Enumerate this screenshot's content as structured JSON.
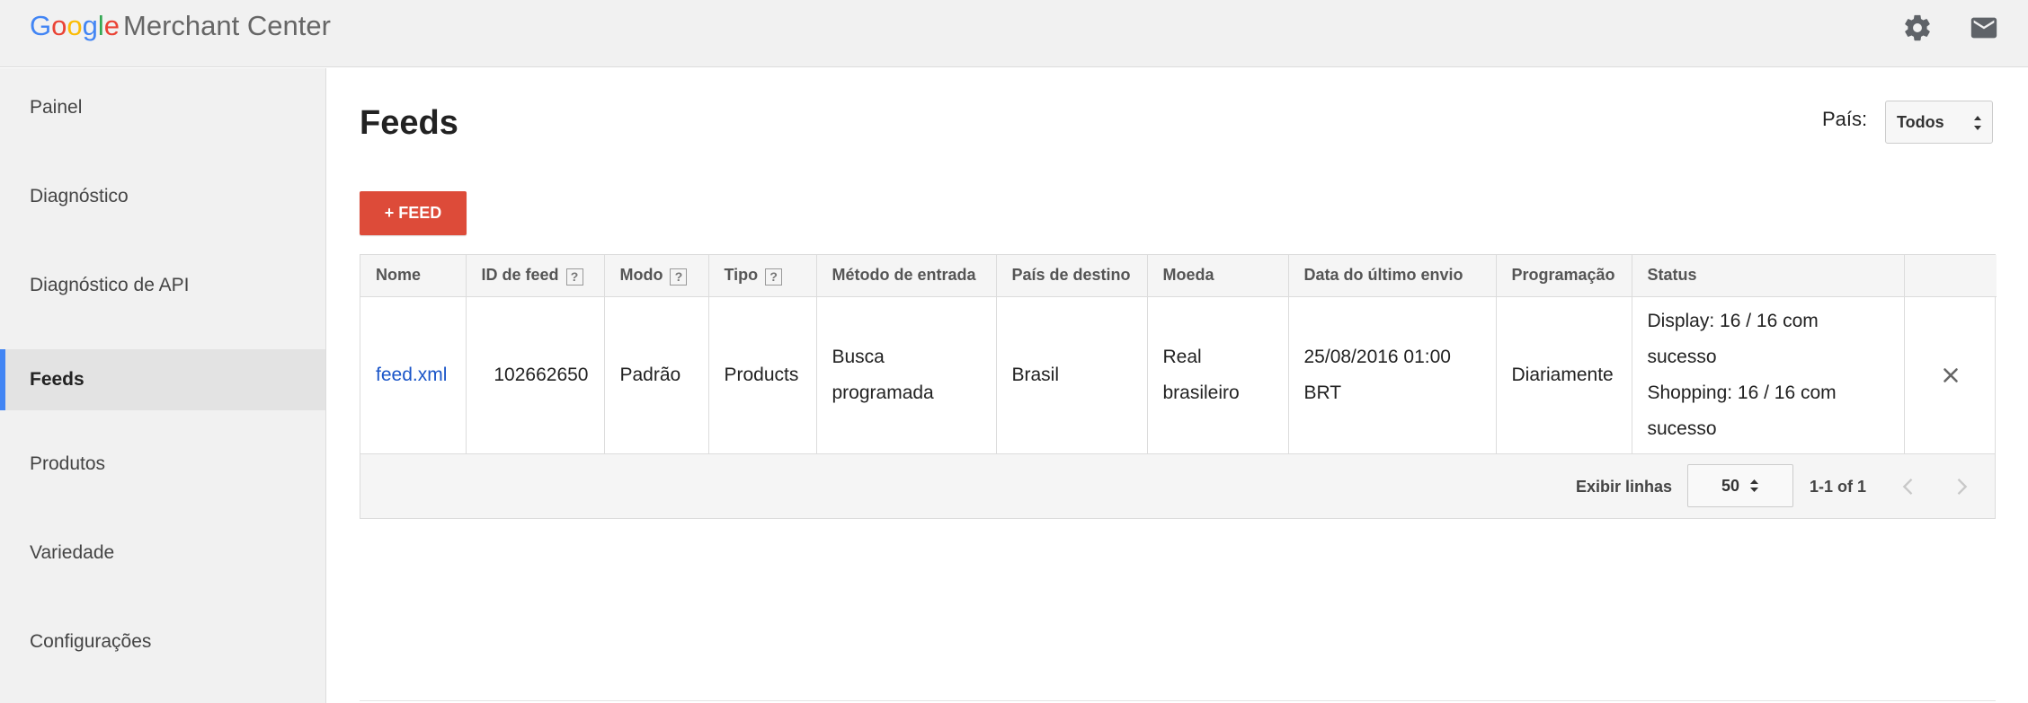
{
  "header": {
    "logo_letters": [
      "G",
      "o",
      "o",
      "g",
      "l",
      "e"
    ],
    "product": "Merchant Center",
    "icons": [
      "gear-icon",
      "mail-icon"
    ]
  },
  "sidebar": {
    "items": [
      {
        "label": "Painel"
      },
      {
        "label": "Diagnóstico"
      },
      {
        "label": "Diagnóstico de API"
      },
      {
        "label": "Feeds",
        "active": true
      },
      {
        "label": "Produtos"
      },
      {
        "label": "Variedade"
      },
      {
        "label": "Configurações"
      }
    ]
  },
  "main": {
    "title": "Feeds",
    "country_label": "País:",
    "country_value": "Todos",
    "add_button": "+ FEED"
  },
  "table": {
    "columns": [
      "Nome",
      "ID de feed",
      "Modo",
      "Tipo",
      "Método de entrada",
      "País de destino",
      "Moeda",
      "Data do último envio",
      "Programação",
      "Status"
    ],
    "help_marker": "?",
    "rows": [
      {
        "name": "feed.xml",
        "id": "102662650",
        "mode": "Padrão",
        "type": "Products",
        "input_method": "Busca programada",
        "country": "Brasil",
        "currency": "Real brasileiro",
        "last_upload": "25/08/2016 01:00 BRT",
        "schedule": "Diariamente",
        "status_display": "Display: 16 / 16 com sucesso",
        "status_shopping": "Shopping: 16 / 16 com sucesso"
      }
    ],
    "footer": {
      "rows_label": "Exibir linhas",
      "rows_value": "50",
      "range": "1-1 of 1"
    }
  },
  "colors": {
    "accent": "#4285f4",
    "button": "#dd4b39",
    "link": "#1a55c8"
  }
}
